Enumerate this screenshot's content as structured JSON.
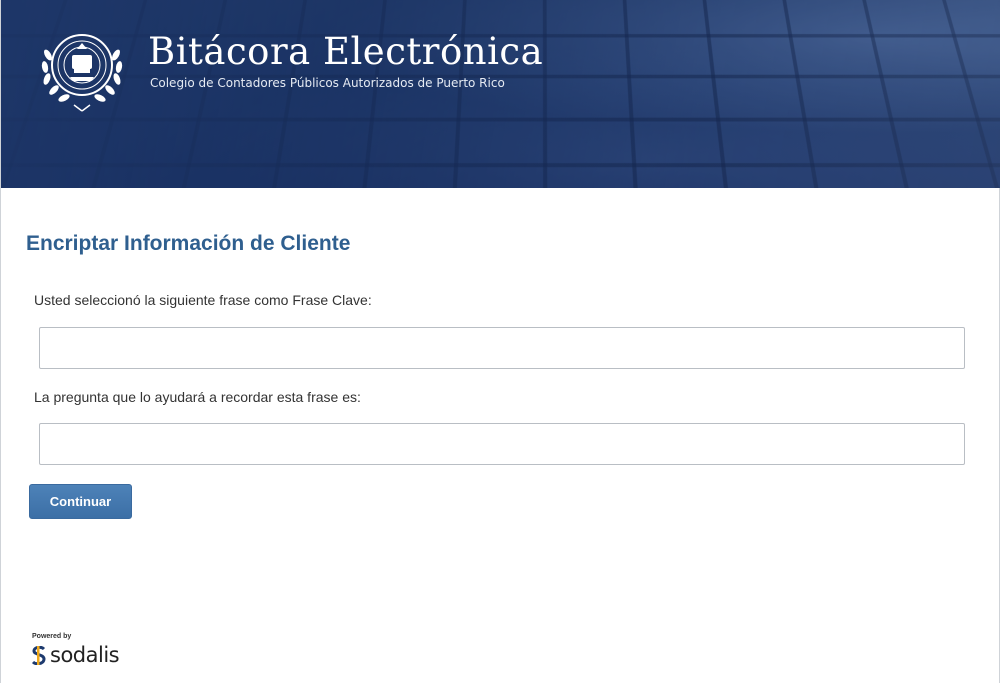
{
  "header": {
    "title": "Bitácora Electrónica",
    "subtitle": "Colegio de Contadores Públicos Autorizados de Puerto Rico",
    "logo_icon": "seal-icon"
  },
  "main": {
    "page_title": "Encriptar Información de Cliente",
    "passphrase_label": "Usted seleccionó la siguiente frase como Frase Clave:",
    "passphrase_value": "",
    "question_label": "La pregunta que lo ayudará a recordar esta frase es:",
    "question_value": "",
    "continue_label": "Continuar"
  },
  "footer": {
    "powered_by": "Powered by",
    "brand": "sodalis"
  },
  "colors": {
    "header_bg": "#183060",
    "title_color": "#2f5f8f",
    "button_bg": "#4479b0"
  }
}
